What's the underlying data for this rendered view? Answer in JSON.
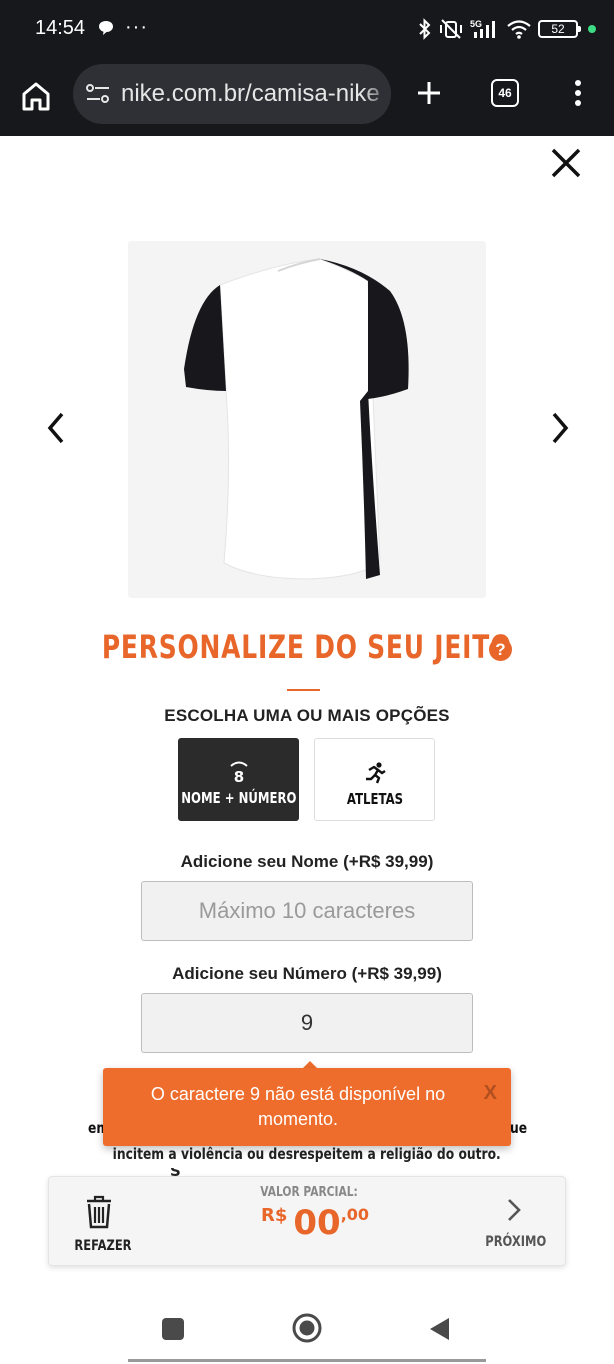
{
  "status_bar": {
    "time": "14:54",
    "dots": "···",
    "network": "5G",
    "battery": "52"
  },
  "browser": {
    "url": "nike.com.br/camisa-nike",
    "tab_count": "46"
  },
  "page": {
    "headline": "PERSONALIZE DO SEU JEITO",
    "help": "?",
    "subhead": "ESCOLHA UMA OU MAIS OPÇÕES",
    "options": [
      {
        "label": "NOME + NÚMERO",
        "selected": true
      },
      {
        "label": "ATLETAS",
        "selected": false
      }
    ],
    "name_field": {
      "label": "Adicione seu Nome (+R$ 39,99)",
      "placeholder": "Máximo 10 caracteres",
      "value": ""
    },
    "number_field": {
      "label": "Adicione seu Número (+R$ 39,99)",
      "value": "9"
    },
    "notice": {
      "left_fragment": "em",
      "right_fragment": "ue",
      "line2": "incitem a violência ou desrespeitem a religião do outro."
    }
  },
  "toast": {
    "message": "O caractere 9 não está disponível no momento.",
    "close": "X"
  },
  "price_bar": {
    "redo_label": "REFAZER",
    "partial_label": "VALOR PARCIAL:",
    "currency": "R$",
    "price_int": "00",
    "price_dec": ",00",
    "next_label": "PRÓXIMO"
  },
  "colors": {
    "accent": "#e8662a",
    "toast": "#ee6d2c",
    "chrome": "#17181c"
  }
}
